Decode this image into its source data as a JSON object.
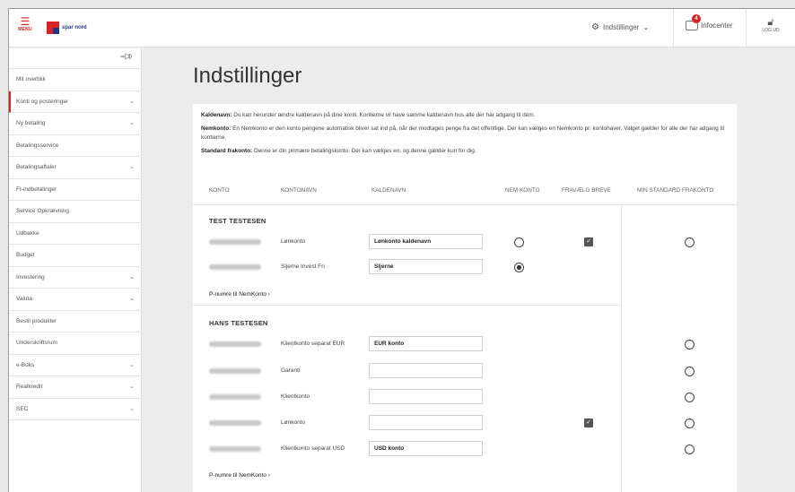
{
  "topbar": {
    "menu_label": "MENU",
    "logo_text": "spar nord",
    "settings_label": "Indstillinger",
    "settings_chevron": "⌄",
    "infocenter_label": "Infocenter",
    "infocenter_count": "4",
    "logout_label": "LOG UD"
  },
  "sidebar": {
    "items": [
      {
        "label": "Mit overblik",
        "chevron": ""
      },
      {
        "label": "Konti og posteringer",
        "chevron": "⌄"
      },
      {
        "label": "Ny betaling",
        "chevron": "⌄"
      },
      {
        "label": "Betalingsservice",
        "chevron": ""
      },
      {
        "label": "Betalingsaftaler",
        "chevron": "⌄"
      },
      {
        "label": "FI-indbetalinger",
        "chevron": ""
      },
      {
        "label": "Service Opkrævning",
        "chevron": ""
      },
      {
        "label": "Udbakke",
        "chevron": ""
      },
      {
        "label": "Budget",
        "chevron": ""
      },
      {
        "label": "Investering",
        "chevron": "⌄"
      },
      {
        "label": "Valuta",
        "chevron": "⌄"
      },
      {
        "label": "Bestil produkter",
        "chevron": ""
      },
      {
        "label": "Underskriftsrum",
        "chevron": ""
      },
      {
        "label": "e-Boks",
        "chevron": "⌄"
      },
      {
        "label": "Realkredit",
        "chevron": "⌄"
      },
      {
        "label": "SEC",
        "chevron": "⌄"
      }
    ]
  },
  "page": {
    "title": "Indstillinger",
    "info": {
      "kaldenavn_label": "Kaldenavn:",
      "kaldenavn_text": " Du kan herunder ændre kaldenavn på dine konti. Kontierne vil have samme kaldenavn hos alle der har adgang til dem.",
      "nemkonto_label": "Nemkonto:",
      "nemkonto_text": " En Nemkonto er den konto pengene automatisk bliver sat ind på, når der modtages penge fra det offentlige. Der kan vælges en Nemkonto pr. kontohaver. Valget gælder for alle der har adgang til kontierne.",
      "frakonto_label": "Standard frakonto:",
      "frakonto_text": " Denne er din primære betalingskonto. Der kan vælges en, og denne gælder kun for dig."
    },
    "columns": {
      "konto": "KONTO",
      "kontonavn": "KONTONAVN",
      "kaldenavn": "KALDENAVN",
      "nemkonto": "NEM KONTO",
      "fravaelg": "FRAVÆLG BREVE",
      "frakonto": "MIN STANDARD FRAKONTO"
    },
    "groups": [
      {
        "name": "TEST TESTESEN",
        "nemkonto_link": "P-numre til NemKonto ›",
        "accounts": [
          {
            "name": "Lønkonto",
            "nickname": "Lønkonto kaldenavn",
            "nem": false,
            "fravaelg": true,
            "frakonto": false
          },
          {
            "name": "Sljerne Invest Fri",
            "nickname": "Sljerne",
            "nem": true,
            "fravaelg": false,
            "frakonto": null
          }
        ]
      },
      {
        "name": "HANS TESTESEN",
        "nemkonto_link": "P-numre til NemKonto ›",
        "accounts": [
          {
            "name": "Klientkonto separat EUR",
            "nickname": "EUR konto",
            "fravaelg": false,
            "frakonto": false
          },
          {
            "name": "Garanti",
            "nickname": "",
            "fravaelg": false,
            "frakonto": false
          },
          {
            "name": "Klientkonto",
            "nickname": "",
            "fravaelg": false,
            "frakonto": false
          },
          {
            "name": "Lønkonto",
            "nickname": "",
            "fravaelg": true,
            "frakonto": false
          },
          {
            "name": "Klientkonto separat USD",
            "nickname": "USD konto",
            "fravaelg": false,
            "frakonto": false
          }
        ]
      }
    ],
    "check_mark": "✓"
  },
  "icons": {
    "menu": "hamburger-icon",
    "settings": "gear-icon",
    "infocenter": "inbox-icon",
    "logout": "lock-icon",
    "pin": "pin-icon"
  },
  "colors": {
    "accent": "#d22222",
    "brand_blue": "#1b3a8c"
  }
}
